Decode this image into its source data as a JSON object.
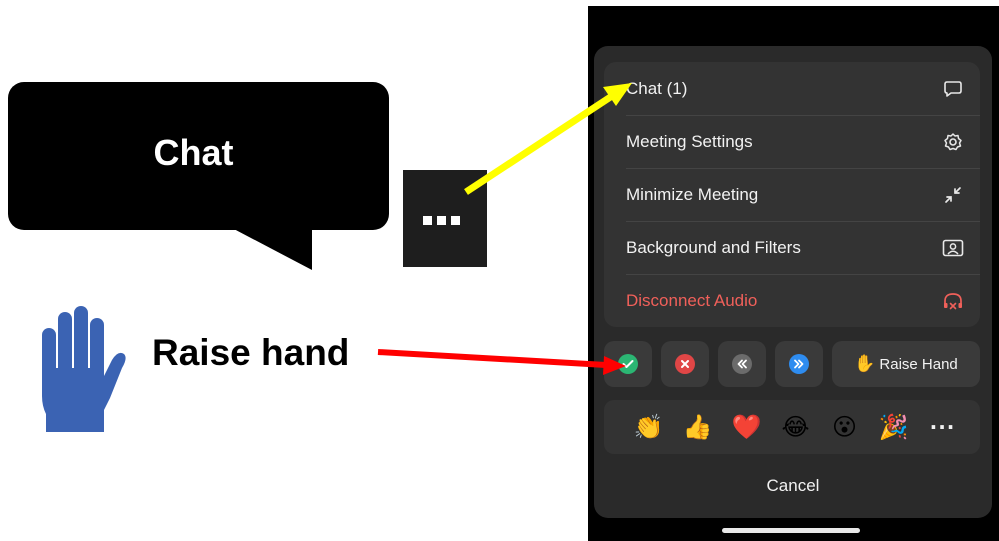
{
  "annotations": {
    "chat_callout": "Chat",
    "raise_hand_callout": "Raise hand",
    "arrow_colors": {
      "chat": "#ffff00",
      "raise_hand": "#ff0000"
    },
    "hand_color": "#3b63b3"
  },
  "menu": {
    "items": [
      {
        "label": "Chat (1)",
        "icon": "chat-bubble-icon"
      },
      {
        "label": "Meeting Settings",
        "icon": "gear-icon"
      },
      {
        "label": "Minimize Meeting",
        "icon": "minimize-icon"
      },
      {
        "label": "Background and Filters",
        "icon": "portrait-icon"
      },
      {
        "label": "Disconnect Audio",
        "icon": "headphones-off-icon"
      }
    ],
    "danger_color": "#f0605a"
  },
  "reactions": {
    "yes": {
      "icon": "check-icon",
      "color": "#2bb673"
    },
    "no": {
      "icon": "x-icon",
      "color": "#e04646"
    },
    "slower": {
      "icon": "rewind-icon",
      "color": "#6b6b6b"
    },
    "faster": {
      "icon": "fast-forward-icon",
      "color": "#2e8cf0"
    },
    "raise_hand": {
      "emoji": "✋",
      "label": "Raise Hand"
    }
  },
  "emojis": [
    "👏",
    "👍",
    "❤️",
    "😂",
    "😮",
    "🎉"
  ],
  "emoji_more": "···",
  "cancel": "Cancel"
}
